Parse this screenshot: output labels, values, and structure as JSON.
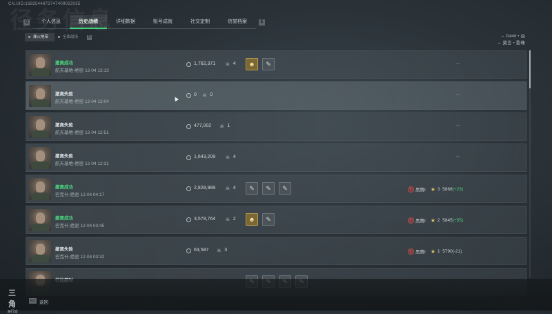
{
  "uid": "CN.UID:1682544873747409022035",
  "header": {
    "bg_title": "径务信息",
    "prev_key": "Q",
    "next_key": "E"
  },
  "tabs": [
    {
      "label": "个人信息",
      "active": false
    },
    {
      "label": "历史战绩",
      "active": true
    },
    {
      "label": "详细数据",
      "active": false
    },
    {
      "label": "账号成就",
      "active": false
    },
    {
      "label": "社交定制",
      "active": false
    },
    {
      "label": "信誉档案",
      "active": false
    }
  ],
  "subtabs": {
    "items": [
      {
        "label": "烽火地带",
        "active": true
      },
      {
        "label": "全面战场",
        "active": false
      }
    ],
    "key": "R"
  },
  "right_names": [
    "Devil・焱",
    "莫言・影珠"
  ],
  "rows": [
    {
      "status": "撤离成功",
      "ok": true,
      "map": "航天基地-绝密",
      "time": "12-04 13:13",
      "value": "1,762,371",
      "kills": "4",
      "badges": [
        "gold",
        "grey"
      ],
      "rank": null
    },
    {
      "status": "撤离失败",
      "ok": false,
      "map": "航天基地-绝密",
      "time": "12-04 13:04",
      "value": "0",
      "kills": "0",
      "badges": [],
      "rank": null
    },
    {
      "status": "撤离失败",
      "ok": false,
      "map": "航天基地-绝密",
      "time": "12-04 12:51",
      "value": "477,002",
      "kills": "1",
      "badges": [],
      "rank": null
    },
    {
      "status": "撤离失败",
      "ok": false,
      "map": "航天基地-绝密",
      "time": "12-04 12:31",
      "value": "1,643,209",
      "kills": "4",
      "badges": [],
      "rank": null
    },
    {
      "status": "撤离成功",
      "ok": true,
      "map": "巴克什-绝密",
      "time": "12-04 04:17",
      "value": "2,828,989",
      "kills": "4",
      "badges": [
        "grey",
        "grey",
        "grey"
      ],
      "rank": {
        "tier": "黑鹰I",
        "stars": "3",
        "score": "5868",
        "delta": "(+23)",
        "plus": true
      }
    },
    {
      "status": "撤离成功",
      "ok": true,
      "map": "巴克什-绝密",
      "time": "12-04 03:45",
      "value": "3,578,764",
      "kills": "2",
      "badges": [
        "gold",
        "grey"
      ],
      "rank": {
        "tier": "黑鹰I",
        "stars": "2",
        "score": "5845",
        "delta": "(+55)",
        "plus": true
      }
    },
    {
      "status": "撤离失败",
      "ok": false,
      "map": "巴克什-绝密",
      "time": "12-04 03:32",
      "value": "63,587",
      "kills": "3",
      "badges": [],
      "rank": {
        "tier": "黑鹰I",
        "stars": "1",
        "score": "5790",
        "delta": "(-21)",
        "plus": false
      }
    },
    {
      "status": "行动超时",
      "ok": false,
      "map": "",
      "time": "",
      "value": "",
      "kills": "",
      "badges": [
        "grey",
        "grey",
        "grey",
        "grey"
      ],
      "rank": null
    }
  ],
  "empty_mark": "--",
  "footer": {
    "esc_key": "Esc",
    "back_label": "返回",
    "logo_top": "三角",
    "logo_bottom": "洲行动"
  },
  "icons": {
    "coin": "coin-icon",
    "skull": "skull-icon",
    "badge_gold": "medal-icon",
    "badge_grey": "item-icon",
    "star": "star-icon",
    "rank": "rank-icon"
  }
}
